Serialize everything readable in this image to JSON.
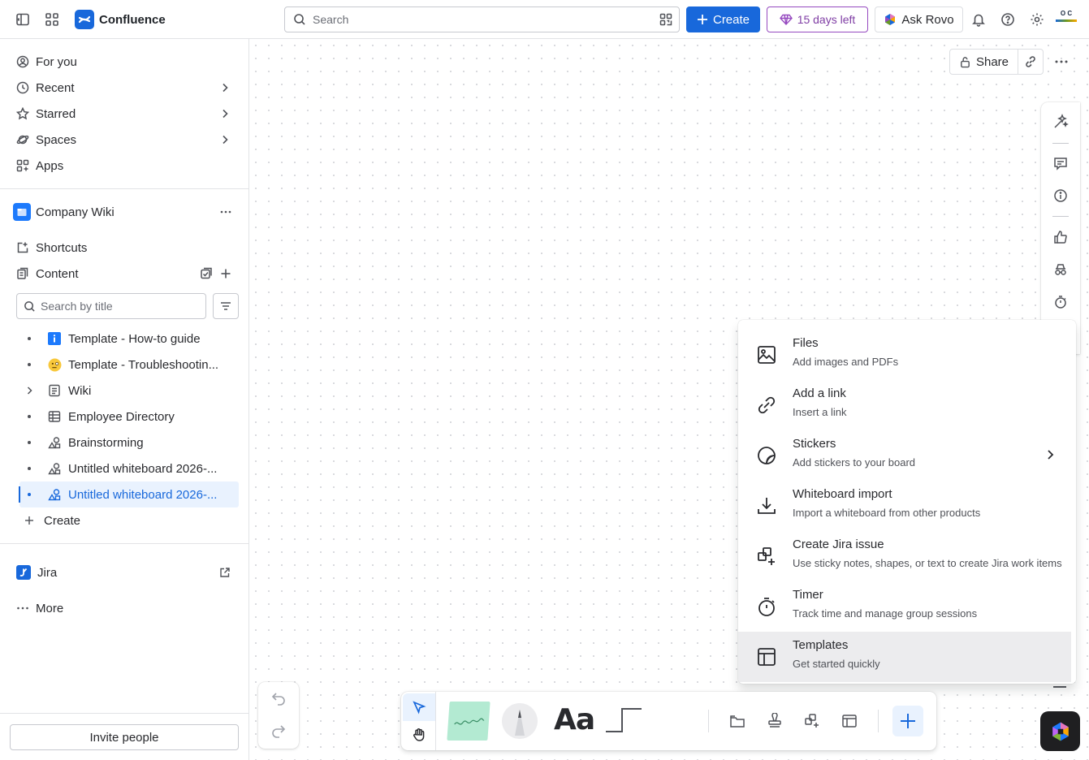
{
  "topbar": {
    "app_name": "Confluence",
    "search_placeholder": "Search",
    "create_label": "Create",
    "trial_label": "15 days left",
    "rovo_label": "Ask Rovo",
    "avatar_text": "O C"
  },
  "sidebar": {
    "nav": [
      {
        "label": "For you"
      },
      {
        "label": "Recent"
      },
      {
        "label": "Starred"
      },
      {
        "label": "Spaces"
      },
      {
        "label": "Apps"
      }
    ],
    "space_name": "Company Wiki",
    "shortcuts_label": "Shortcuts",
    "content_label": "Content",
    "title_search_placeholder": "Search by title",
    "tree": [
      {
        "label": "Template - How-to guide",
        "icon": "info-icon"
      },
      {
        "label": "Template - Troubleshootin...",
        "icon": "emoji-icon"
      },
      {
        "label": "Wiki",
        "icon": "page-icon"
      },
      {
        "label": "Employee Directory",
        "icon": "database-icon"
      },
      {
        "label": "Brainstorming",
        "icon": "whiteboard-icon"
      },
      {
        "label": "Untitled whiteboard 2026-...",
        "icon": "whiteboard-icon"
      },
      {
        "label": "Untitled whiteboard 2026-...",
        "icon": "whiteboard-icon"
      }
    ],
    "create_label": "Create",
    "jira_label": "Jira",
    "more_label": "More",
    "invite_label": "Invite people"
  },
  "canvas": {
    "share_label": "Share"
  },
  "insert_menu": {
    "items": [
      {
        "title": "Files",
        "desc": "Add images and PDFs"
      },
      {
        "title": "Add a link",
        "desc": "Insert a link"
      },
      {
        "title": "Stickers",
        "desc": "Add stickers to your board"
      },
      {
        "title": "Whiteboard import",
        "desc": "Import a whiteboard from other products"
      },
      {
        "title": "Create Jira issue",
        "desc": "Use sticky notes, shapes, or text to create Jira work items"
      },
      {
        "title": "Timer",
        "desc": "Track time and manage group sessions"
      },
      {
        "title": "Templates",
        "desc": "Get started quickly"
      }
    ]
  },
  "toolbar": {
    "text_tool": "Aa"
  },
  "colors": {
    "brand_blue": "#1868db",
    "trial_purple": "#964ac0",
    "sticky_green": "#b3ead2",
    "menu_hover": "#ececee"
  }
}
